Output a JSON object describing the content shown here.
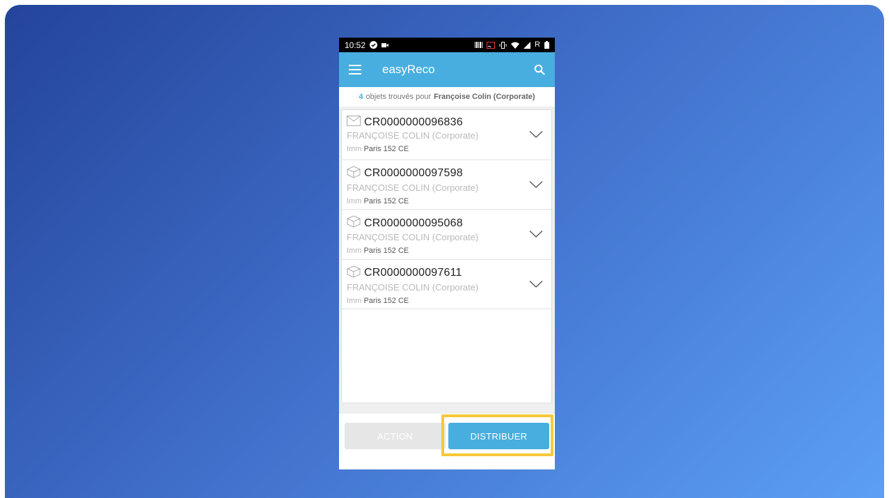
{
  "status_bar": {
    "time": "10:52",
    "left_icons": [
      "check-circle-icon",
      "video-icon"
    ],
    "right_icons": [
      "barcode-icon",
      "cast-icon",
      "vibrate-icon",
      "wifi-icon",
      "signal-icon",
      "roaming-icon",
      "battery-icon"
    ],
    "roaming_label": "R"
  },
  "app_bar": {
    "title": "easyReco",
    "menu_icon": "menu-icon",
    "search_icon": "search-icon",
    "color": "#48aedf"
  },
  "summary": {
    "count": "4",
    "label": "objets trouvés pour",
    "person": "Françoise Colin (Corporate)"
  },
  "items": [
    {
      "icon": "envelope-icon",
      "ref": "CR0000000096836",
      "name": "FRANÇOISE COLIN (Corporate)",
      "loc_prefix": "Imm",
      "loc_place": "Paris 152 CE"
    },
    {
      "icon": "package-icon",
      "ref": "CR0000000097598",
      "name": "FRANÇOISE COLIN (Corporate)",
      "loc_prefix": "Imm",
      "loc_place": "Paris 152 CE"
    },
    {
      "icon": "package-icon",
      "ref": "CR0000000095068",
      "name": "FRANÇOISE COLIN (Corporate)",
      "loc_prefix": "Imm",
      "loc_place": "Paris 152 CE"
    },
    {
      "icon": "package-icon",
      "ref": "CR0000000097611",
      "name": "FRANÇOISE COLIN (Corporate)",
      "loc_prefix": "Imm",
      "loc_place": "Paris 152 CE"
    }
  ],
  "buttons": {
    "action_label": "ACTION",
    "distribuer_label": "DISTRIBUER"
  },
  "colors": {
    "accent": "#48aedf",
    "highlight": "#f6c83a",
    "background_start": "#24449a",
    "background_end": "#5c9ff5"
  }
}
